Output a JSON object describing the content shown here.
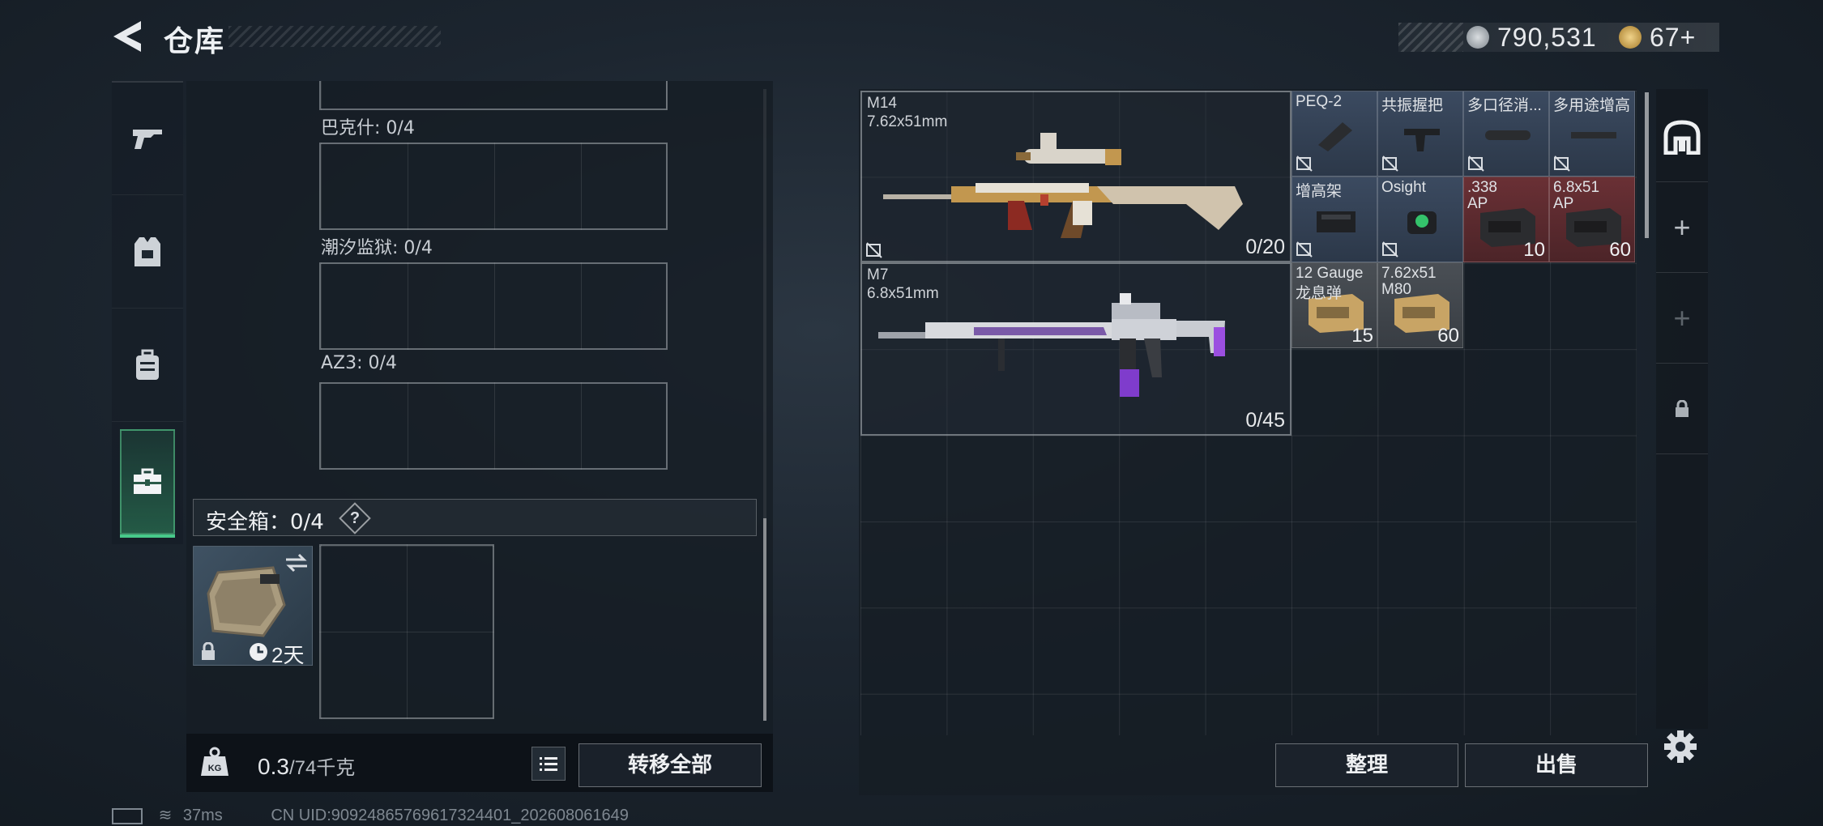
{
  "header": {
    "title": "仓库"
  },
  "currency": {
    "silver": "790,531",
    "gold": "67+"
  },
  "left_nav": {
    "items": [
      "weapons",
      "armor",
      "backpack",
      "safebox"
    ],
    "active": "safebox"
  },
  "containers": [
    {
      "label": "巴克什: 0/4"
    },
    {
      "label": "潮汐监狱: 0/4"
    },
    {
      "label": "AZ3: 0/4"
    }
  ],
  "safebox": {
    "label": "安全箱：0/4",
    "help": "?",
    "timer": "2天"
  },
  "bottom_left": {
    "weight": "0.3",
    "weight_unit": "/74千克",
    "transfer_all": "转移全部"
  },
  "stash": {
    "weapons": [
      {
        "name": "M14",
        "caliber": "7.62x51mm",
        "ammo": "0/20"
      },
      {
        "name": "M7",
        "caliber": "6.8x51mm",
        "ammo": "0/45"
      }
    ],
    "items": [
      {
        "name": "PEQ-2",
        "name2": "",
        "count": "",
        "color": "blue"
      },
      {
        "name": "共振握把",
        "name2": "",
        "count": "",
        "color": "blue"
      },
      {
        "name": "多口径消...",
        "name2": "",
        "count": "",
        "color": "blue"
      },
      {
        "name": "多用途增高",
        "name2": "",
        "count": "",
        "color": "blue"
      },
      {
        "name": "增高架",
        "name2": "",
        "count": "",
        "color": "blue"
      },
      {
        "name": "Osight",
        "name2": "",
        "count": "",
        "color": "blue"
      },
      {
        "name": ".338",
        "name2": "AP",
        "count": "10",
        "color": "red"
      },
      {
        "name": "6.8x51",
        "name2": "AP",
        "count": "60",
        "color": "red"
      },
      {
        "name": "12 Gauge",
        "name2": "龙息弹",
        "count": "15",
        "color": "tan"
      },
      {
        "name": "7.62x51",
        "name2": "M80",
        "count": "60",
        "color": "tan"
      }
    ],
    "sort_label": "整理",
    "sell_label": "出售"
  },
  "status_bar": {
    "ping": "37ms",
    "uid": "CN UID:90924865769617324401_202608061649"
  }
}
